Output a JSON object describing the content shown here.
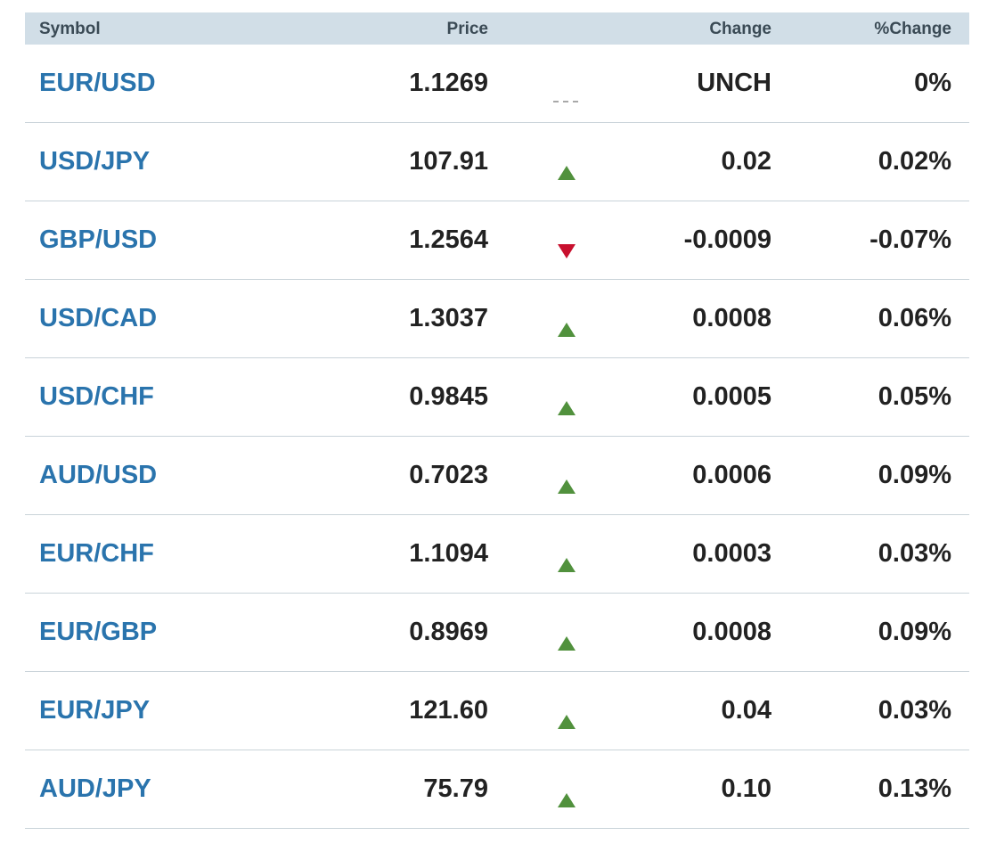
{
  "table": {
    "headers": {
      "symbol": "Symbol",
      "price": "Price",
      "change": "Change",
      "pct_change": "%Change"
    },
    "colors": {
      "header_bg": "#d1dee7",
      "symbol_link": "#2a74ad",
      "up_arrow": "#51913d",
      "down_arrow": "#c8102e",
      "unchanged_marker": "#a8a8a8"
    },
    "rows": [
      {
        "symbol": "EUR/USD",
        "price": "1.1269",
        "direction": "unch",
        "change": "UNCH",
        "pct_change": "0%"
      },
      {
        "symbol": "USD/JPY",
        "price": "107.91",
        "direction": "up",
        "change": "0.02",
        "pct_change": "0.02%"
      },
      {
        "symbol": "GBP/USD",
        "price": "1.2564",
        "direction": "down",
        "change": "-0.0009",
        "pct_change": "-0.07%"
      },
      {
        "symbol": "USD/CAD",
        "price": "1.3037",
        "direction": "up",
        "change": "0.0008",
        "pct_change": "0.06%"
      },
      {
        "symbol": "USD/CHF",
        "price": "0.9845",
        "direction": "up",
        "change": "0.0005",
        "pct_change": "0.05%"
      },
      {
        "symbol": "AUD/USD",
        "price": "0.7023",
        "direction": "up",
        "change": "0.0006",
        "pct_change": "0.09%"
      },
      {
        "symbol": "EUR/CHF",
        "price": "1.1094",
        "direction": "up",
        "change": "0.0003",
        "pct_change": "0.03%"
      },
      {
        "symbol": "EUR/GBP",
        "price": "0.8969",
        "direction": "up",
        "change": "0.0008",
        "pct_change": "0.09%"
      },
      {
        "symbol": "EUR/JPY",
        "price": "121.60",
        "direction": "up",
        "change": "0.04",
        "pct_change": "0.03%"
      },
      {
        "symbol": "AUD/JPY",
        "price": "75.79",
        "direction": "up",
        "change": "0.10",
        "pct_change": "0.13%"
      }
    ]
  }
}
